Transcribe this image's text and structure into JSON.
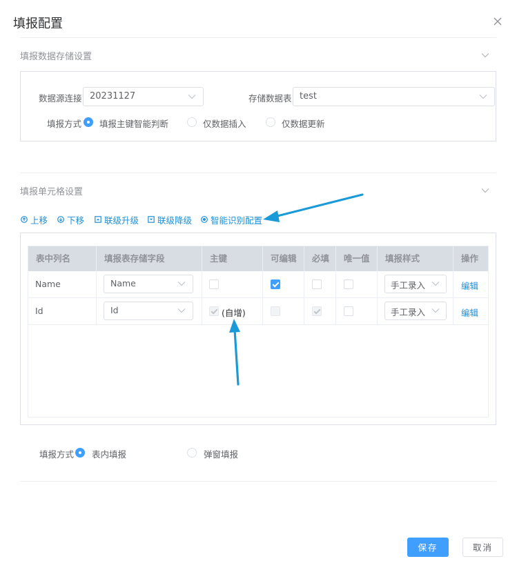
{
  "dialog": {
    "title": "填报配置",
    "close_icon": "close-icon"
  },
  "storage": {
    "section_title": "填报数据存储设置",
    "datasource_label": "数据源连接",
    "datasource_value": "20231127",
    "table_label": "存储数据表",
    "table_value": "test",
    "mode_label": "填报方式",
    "mode_options": [
      "填报主键智能判断",
      "仅数据插入",
      "仅数据更新"
    ],
    "mode_selected": "填报主键智能判断"
  },
  "cells": {
    "section_title": "填报单元格设置",
    "toolbar": {
      "up": "上移",
      "down": "下移",
      "cascade_up": "联级升级",
      "cascade_down": "联级降级",
      "smart_config": "智能识别配置"
    },
    "columns": [
      "表中列名",
      "填报表存储字段",
      "主键",
      "可编辑",
      "必填",
      "唯一值",
      "填报样式",
      "操作"
    ],
    "rows": [
      {
        "name": "Name",
        "field": "Name",
        "primary_key": false,
        "primary_key_note": "",
        "editable": true,
        "required": false,
        "unique": false,
        "style": "手工录入",
        "action": "编辑"
      },
      {
        "name": "Id",
        "field": "Id",
        "primary_key": true,
        "primary_key_note": "(自增)",
        "editable": false,
        "required": true,
        "unique": false,
        "style": "手工录入",
        "action": "编辑"
      }
    ],
    "fill_mode_label": "填报方式",
    "fill_mode_options": [
      "表内填报",
      "弹窗填报"
    ],
    "fill_mode_selected": "表内填报"
  },
  "footer": {
    "save": "保存",
    "cancel": "取消"
  },
  "colors": {
    "primary": "#409eff",
    "link": "#1e8fd6",
    "annotation_arrow": "#1a9ad6",
    "header_bg": "#d7dde3"
  }
}
